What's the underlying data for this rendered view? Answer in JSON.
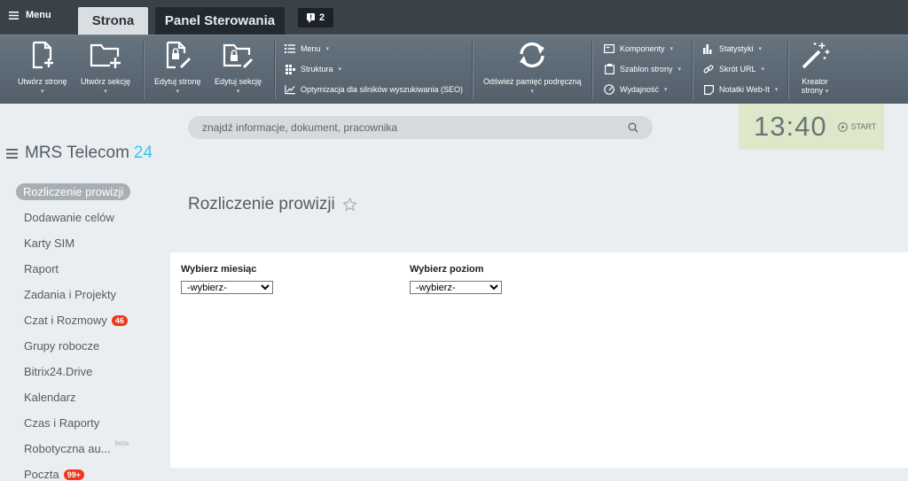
{
  "topbar": {
    "menu_label": "Menu",
    "tabs": [
      {
        "label": "Strona",
        "active": true
      },
      {
        "label": "Panel Sterowania",
        "active": false
      }
    ],
    "notifications_count": "2"
  },
  "toolbar": {
    "big_buttons": [
      {
        "label": "Utwórz stronę",
        "icon": "new-page-icon"
      },
      {
        "label": "Utwórz sekcję",
        "icon": "new-folder-icon"
      },
      {
        "label": "Edytuj stronę",
        "icon": "edit-page-icon"
      },
      {
        "label": "Edytuj sekcję",
        "icon": "edit-folder-icon"
      },
      {
        "label": "Odśwież pamięć podręczną",
        "icon": "refresh-icon"
      },
      {
        "label": "Kreator",
        "label2": "strony",
        "icon": "wizard-icon"
      }
    ],
    "small_buttons": [
      {
        "label": "Menu",
        "icon": "list-icon",
        "dropdown": true
      },
      {
        "label": "Struktura",
        "icon": "structure-icon",
        "dropdown": true
      },
      {
        "label": "Optymizacja dla silników wyszukiwania (SEO)",
        "icon": "seo-chart-icon",
        "dropdown": false
      },
      {
        "label": "Komponenty",
        "icon": "component-icon",
        "dropdown": true
      },
      {
        "label": "Szablon strony",
        "icon": "template-icon",
        "dropdown": true
      },
      {
        "label": "Wydajność",
        "icon": "gauge-icon",
        "dropdown": true
      },
      {
        "label": "Statystyki",
        "icon": "stats-icon",
        "dropdown": true
      },
      {
        "label": "Skrót URL",
        "icon": "link-icon",
        "dropdown": true
      },
      {
        "label": "Notatki Web-It",
        "icon": "note-icon",
        "dropdown": true
      }
    ]
  },
  "search": {
    "placeholder": "znajdź informacje, dokument, pracownika"
  },
  "clock": {
    "time": "13:40",
    "start_label": "START"
  },
  "brand": {
    "name": "MRS Telecom",
    "number": "24"
  },
  "nav": [
    {
      "label": "Rozliczenie prowizji",
      "active": true
    },
    {
      "label": "Dodawanie celów"
    },
    {
      "label": "Karty SIM"
    },
    {
      "label": "Raport"
    },
    {
      "label": "Zadania i Projekty"
    },
    {
      "label": "Czat i Rozmowy",
      "badge": "46"
    },
    {
      "label": "Grupy robocze"
    },
    {
      "label": "Bitrix24.Drive"
    },
    {
      "label": "Kalendarz"
    },
    {
      "label": "Czas i Raporty"
    },
    {
      "label": "Robotyczna au...",
      "beta": "beta"
    },
    {
      "label": "Poczta",
      "badge": "99+"
    }
  ],
  "main": {
    "title": "Rozliczenie prowizji",
    "month_label": "Wybierz miesiąc",
    "month_value": "-wybierz-",
    "level_label": "Wybierz poziom",
    "level_value": "-wybierz-"
  },
  "colors": {
    "brand_accent": "#2fc6f6",
    "badge": "#f1361a",
    "clock_bg": "#dce8c9"
  }
}
